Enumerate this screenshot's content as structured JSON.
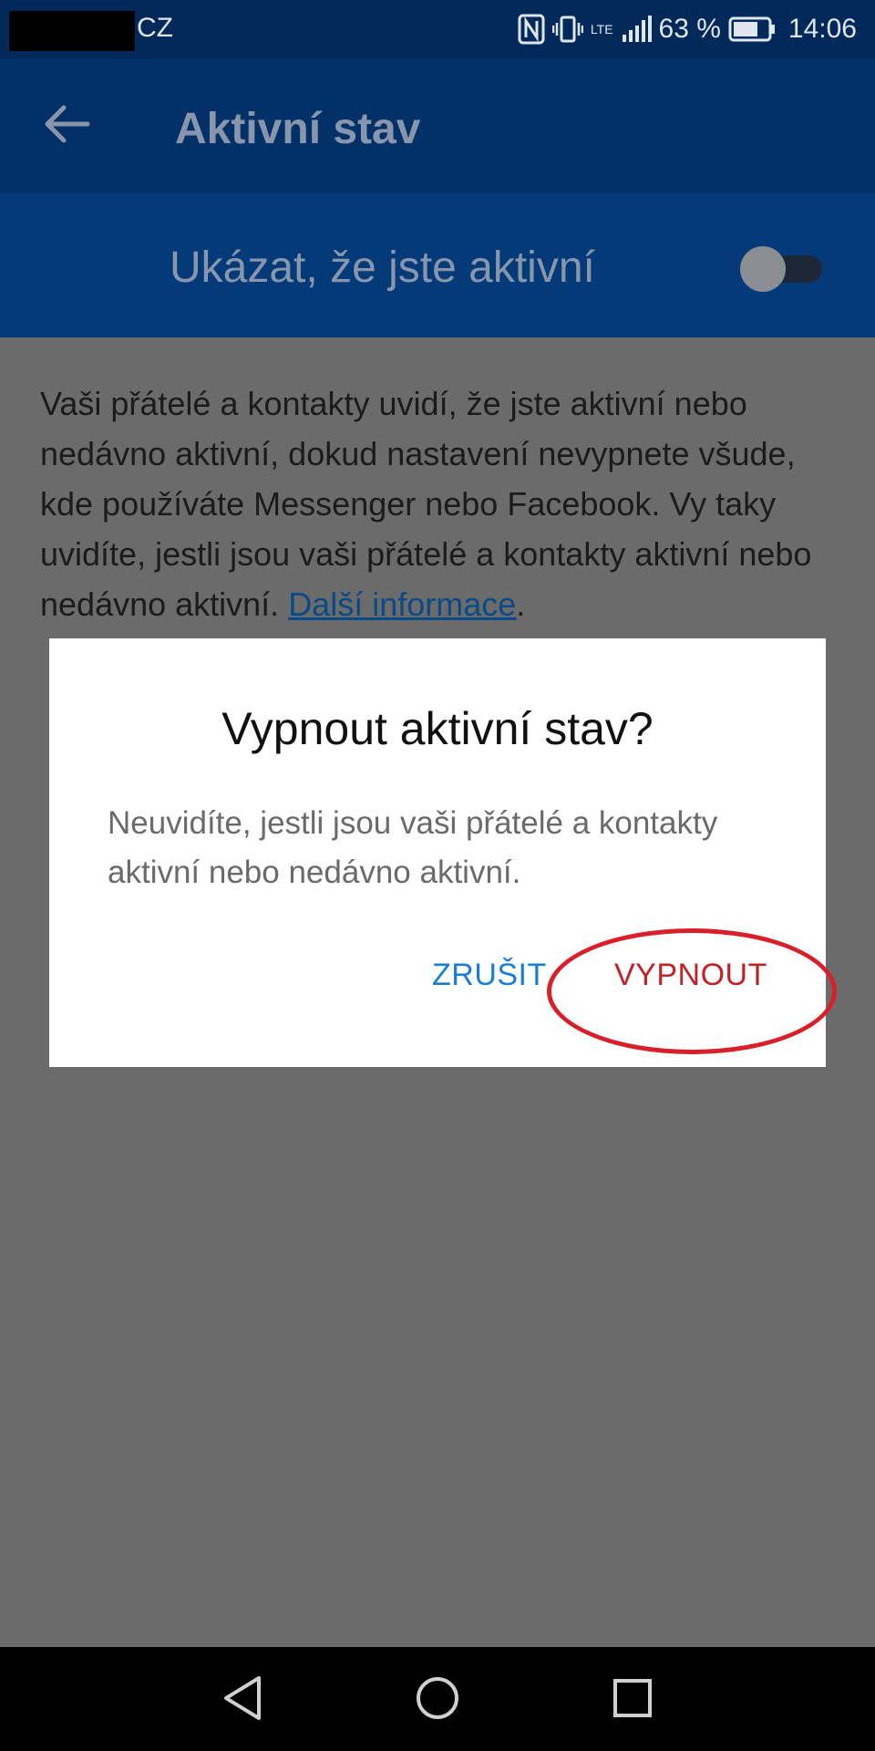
{
  "status_bar": {
    "carrier": "CZ",
    "network": "LTE",
    "battery": "63 %",
    "time": "14:06",
    "icons": [
      "nfc-icon",
      "vibrate-icon",
      "signal-icon",
      "battery-icon"
    ]
  },
  "toolbar": {
    "back_icon": "back-arrow-icon",
    "title": "Aktivní stav"
  },
  "active_setting": {
    "label": "Ukázat, že jste aktivní",
    "enabled": false
  },
  "description": {
    "text": "Vaši přátelé a kontakty uvidí, že jste aktivní nebo nedávno aktivní, dokud nastavení nevypnete všude, kde používáte Messenger nebo Facebook. Vy taky uvidíte, jestli jsou vaši přátelé a kontakty aktivní nebo nedávno aktivní. ",
    "link": "Další informace",
    "end": "."
  },
  "dialog": {
    "title": "Vypnout aktivní stav?",
    "body": "Neuvidíte, jestli jsou vaši přátelé a kontakty aktivní nebo nedávno aktivní.",
    "cancel": "ZRUŠIT",
    "confirm": "VYPNOUT"
  },
  "nav_bar": {
    "icons": [
      "nav-back-icon",
      "nav-home-icon",
      "nav-recent-icon"
    ]
  },
  "colors": {
    "dialog_cancel": "#1a7fd4",
    "dialog_confirm": "#c0242a",
    "highlight": "#d9202a",
    "header": "#043a78"
  }
}
